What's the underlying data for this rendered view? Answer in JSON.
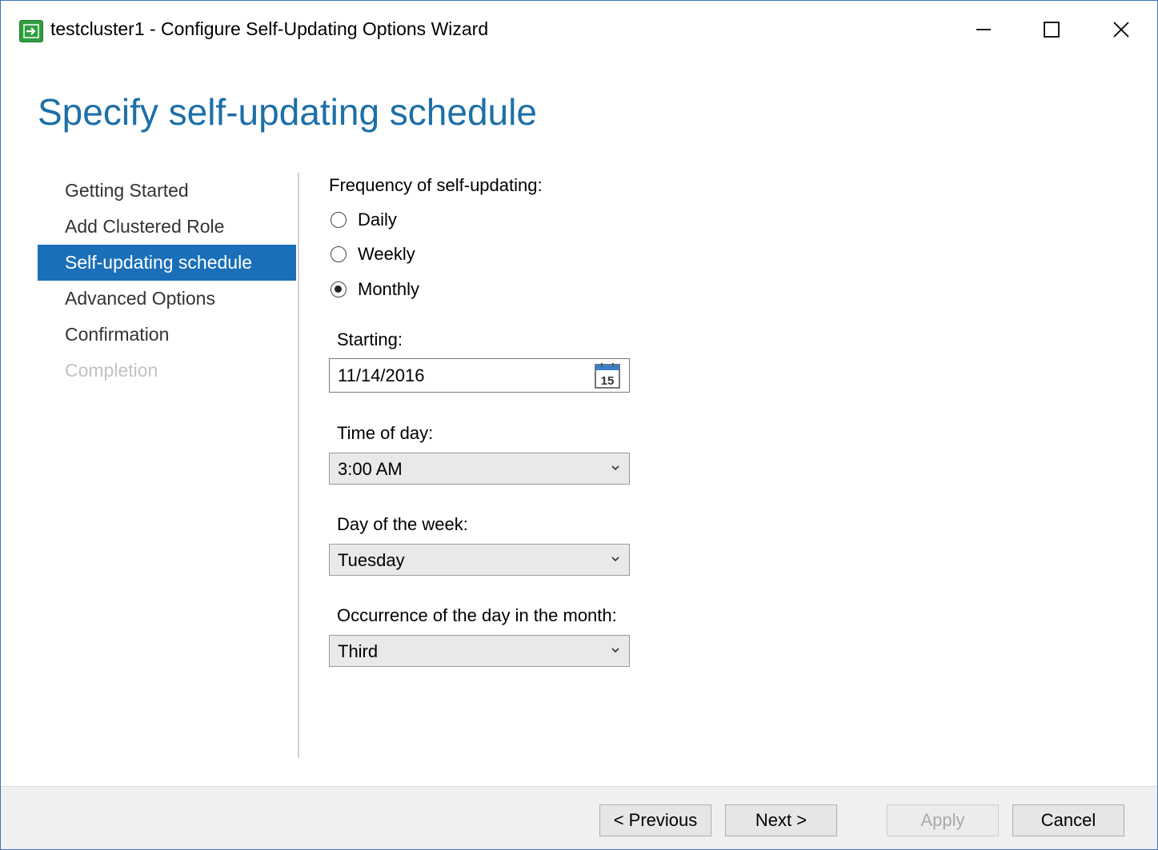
{
  "window": {
    "title": "testcluster1 - Configure Self-Updating Options Wizard",
    "controls": {
      "minimize": "minimize-icon",
      "maximize": "maximize-icon",
      "close": "close-icon"
    }
  },
  "page": {
    "title": "Specify self-updating schedule"
  },
  "nav": {
    "items": [
      {
        "label": "Getting Started",
        "state": "normal"
      },
      {
        "label": "Add Clustered Role",
        "state": "normal"
      },
      {
        "label": "Self-updating schedule",
        "state": "active"
      },
      {
        "label": "Advanced Options",
        "state": "normal"
      },
      {
        "label": "Confirmation",
        "state": "normal"
      },
      {
        "label": "Completion",
        "state": "disabled"
      }
    ]
  },
  "form": {
    "frequency_label": "Frequency of self-updating:",
    "frequency_options": [
      {
        "label": "Daily",
        "checked": false
      },
      {
        "label": "Weekly",
        "checked": false
      },
      {
        "label": "Monthly",
        "checked": true
      }
    ],
    "starting_label": "Starting:",
    "starting_value": "11/14/2016",
    "calendar_icon_text": "15",
    "time_label": "Time of day:",
    "time_value": "3:00 AM",
    "day_label": "Day of the week:",
    "day_value": "Tuesday",
    "occurrence_label": "Occurrence of the day in the month:",
    "occurrence_value": "Third"
  },
  "buttons": {
    "previous": "< Previous",
    "next": "Next >",
    "apply": "Apply",
    "cancel": "Cancel"
  },
  "colors": {
    "accent": "#1b6fb8",
    "title_blue": "#1d6fa8",
    "window_border": "#3a73c4",
    "app_icon_green": "#2f9e3f"
  }
}
